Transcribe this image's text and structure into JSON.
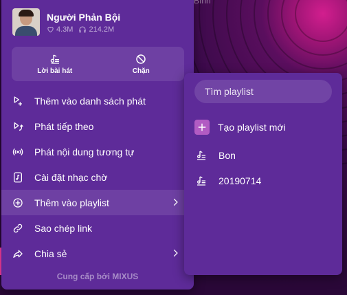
{
  "song": {
    "title": "Người Phản Bội",
    "likes": "4.3M",
    "listens": "214.2M"
  },
  "background": {
    "partial_text": "h Bình"
  },
  "quick_actions": [
    {
      "label": "Lời bài hát",
      "icon": "lyrics-icon"
    },
    {
      "label": "Chặn",
      "icon": "block-icon"
    }
  ],
  "menu_items": [
    {
      "label": "Thêm vào danh sách phát",
      "icon": "add-queue-icon"
    },
    {
      "label": "Phát tiếp theo",
      "icon": "play-next-icon"
    },
    {
      "label": "Phát nội dung tương tự",
      "icon": "radio-icon"
    },
    {
      "label": "Cài đặt nhạc chờ",
      "icon": "ringtone-icon"
    },
    {
      "label": "Thêm vào playlist",
      "icon": "add-circle-icon",
      "has_submenu": true,
      "active": true
    },
    {
      "label": "Sao chép link",
      "icon": "link-icon"
    },
    {
      "label": "Chia sẻ",
      "icon": "share-icon",
      "has_submenu": true
    }
  ],
  "provider_text": "Cung cấp bởi MIXUS",
  "submenu": {
    "search_placeholder": "Tìm playlist",
    "create_label": "Tạo playlist mới",
    "playlists": [
      "Bon",
      "20190714"
    ]
  },
  "colors": {
    "menu_bg": "#5e2b99",
    "accent_plus": "#b25bc3",
    "background_pink": "#d21e8e"
  }
}
